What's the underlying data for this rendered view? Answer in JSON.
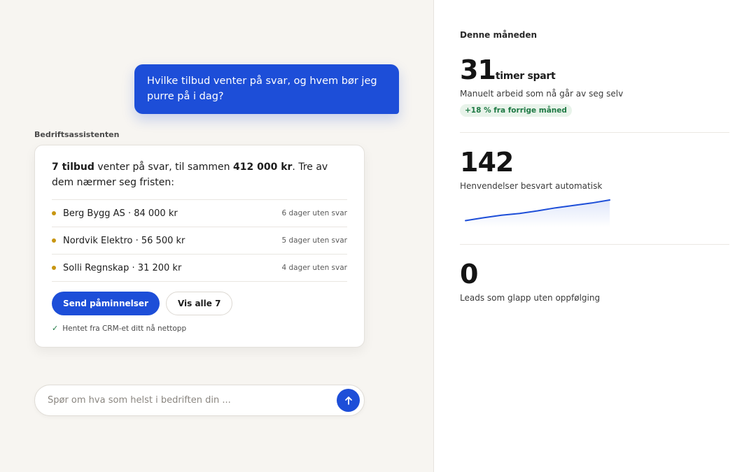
{
  "chat": {
    "user_message": "Hvilke tilbud venter på svar, og hvem bør jeg purre på i dag?",
    "assistant_name": "Bedriftsassistenten",
    "intro": {
      "count": "7 tilbud",
      "text1": " venter på svar, til sammen ",
      "total": "412 000 kr",
      "text2": ". Tre av dem nærmer seg fristen:"
    },
    "offers": [
      {
        "name": "Berg Bygg AS · 84 000 kr",
        "status": "6 dager uten svar"
      },
      {
        "name": "Nordvik Elektro · 56 500 kr",
        "status": "5 dager uten svar"
      },
      {
        "name": "Solli Regnskap · 31 200 kr",
        "status": "4 dager uten svar"
      }
    ],
    "primary_button": "Send påminnelser",
    "secondary_button": "Vis alle 7",
    "source_note": "Hentet fra CRM-et ditt nå nettopp",
    "input_placeholder": "Spør om hva som helst i bedriften din ...",
    "accent_color": "#1d4ed8",
    "dot_color": "#c89612"
  },
  "stats": {
    "section_title": "Denne måneden",
    "hours": {
      "value": "31",
      "unit": "timer spart",
      "label": "Manuelt arbeid som nå går av seg selv",
      "badge": "+18 % fra forrige måned"
    },
    "inquiries": {
      "value": "142",
      "label": "Henvendelser besvart automatisk",
      "trend": [
        0.05,
        0.18,
        0.3,
        0.38,
        0.5,
        0.64,
        0.75,
        0.86,
        1.0
      ]
    },
    "leads": {
      "value": "0",
      "label": "Leads som glapp uten oppfølging"
    }
  }
}
